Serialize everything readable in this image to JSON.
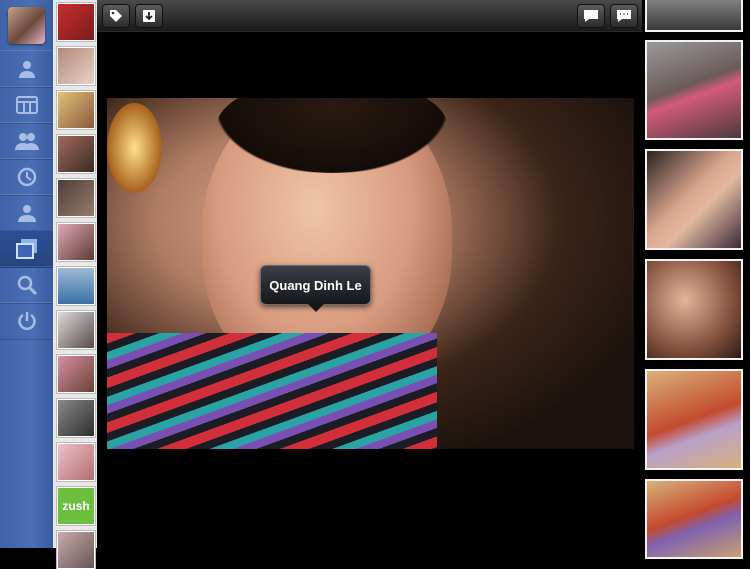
{
  "nav": {
    "avatar_icon": "profile-photo",
    "items": [
      {
        "name": "profile",
        "icon": "person-icon",
        "active": false
      },
      {
        "name": "albums",
        "icon": "grid-icon",
        "active": false
      },
      {
        "name": "friends",
        "icon": "people-icon",
        "active": false
      },
      {
        "name": "events",
        "icon": "clock-icon",
        "active": false
      },
      {
        "name": "groups",
        "icon": "group-icon",
        "active": false
      },
      {
        "name": "photos",
        "icon": "photos-icon",
        "active": true
      },
      {
        "name": "search",
        "icon": "search-icon",
        "active": false
      },
      {
        "name": "power",
        "icon": "power-icon",
        "active": false
      }
    ]
  },
  "viewer": {
    "toolbar": {
      "tag_button_icon": "tag-icon",
      "download_button_icon": "download-icon",
      "comment_button_icon": "comment-icon",
      "comments_button_icon": "comments-icon"
    },
    "tag_label": "Quang Dinh Le"
  },
  "strip": {
    "last_thumb_text": "zush"
  },
  "colors": {
    "nav_blue": "#4a6fb5",
    "active_nav": "#25447f"
  }
}
